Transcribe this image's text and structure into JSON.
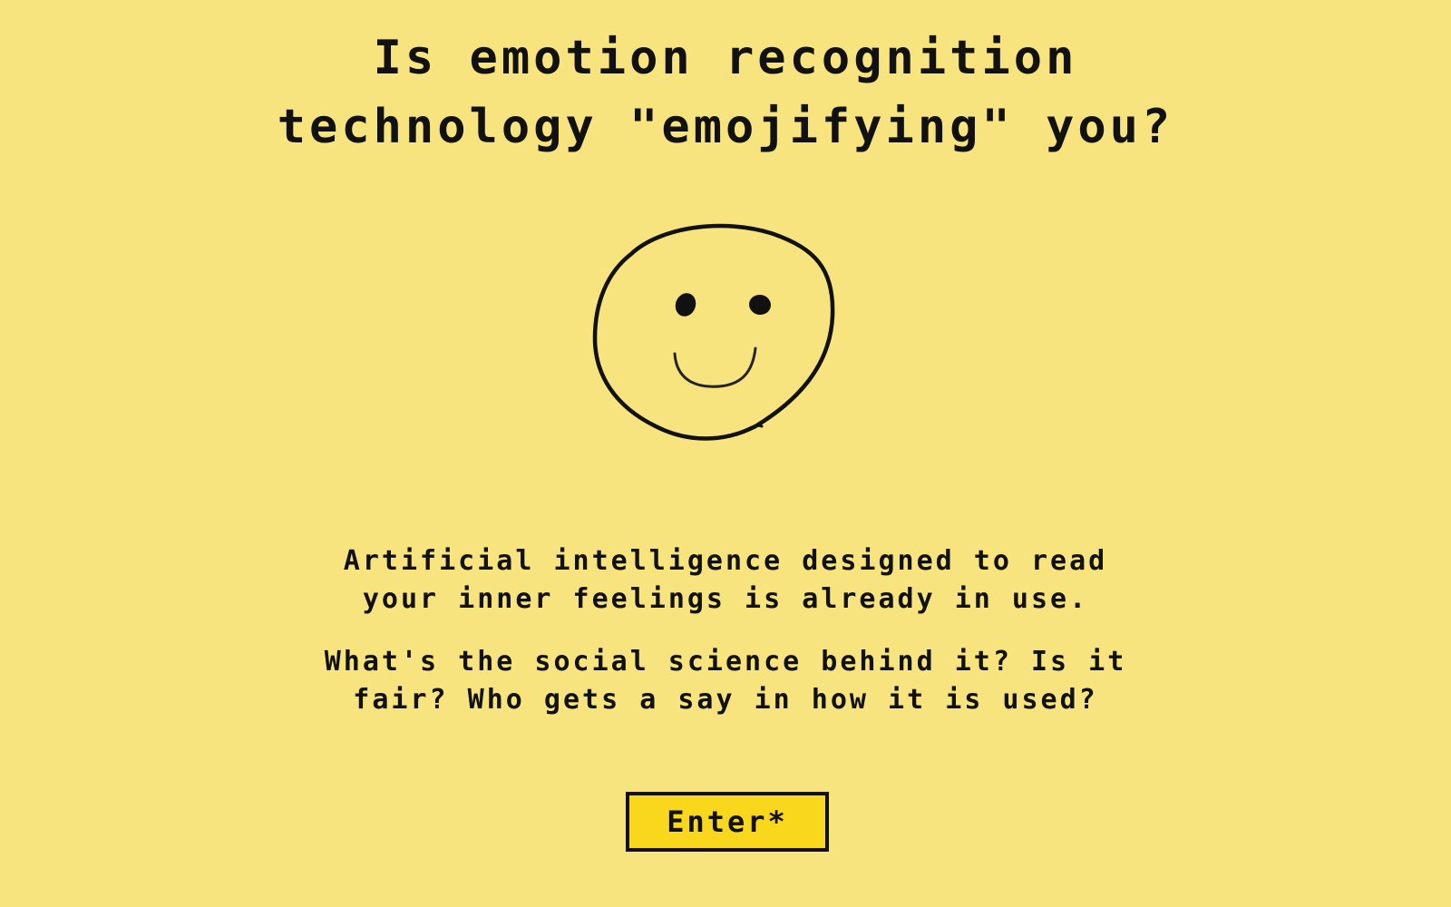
{
  "page": {
    "title_line1": "Is emotion recognition",
    "title_line2": "technology \"emojifying\" you?",
    "illustration": "hand-drawn-smiley-face",
    "intro_line1": "Artificial intelligence designed to read",
    "intro_line2": "your inner feelings is already in use.",
    "questions_line1": "What's the social science behind it? Is it",
    "questions_line2": "fair? Who gets a say in how it is used?",
    "enter_label": "Enter*"
  },
  "colors": {
    "background": "#F7E47E",
    "button_fill": "#F9D71C",
    "text": "#111111"
  }
}
